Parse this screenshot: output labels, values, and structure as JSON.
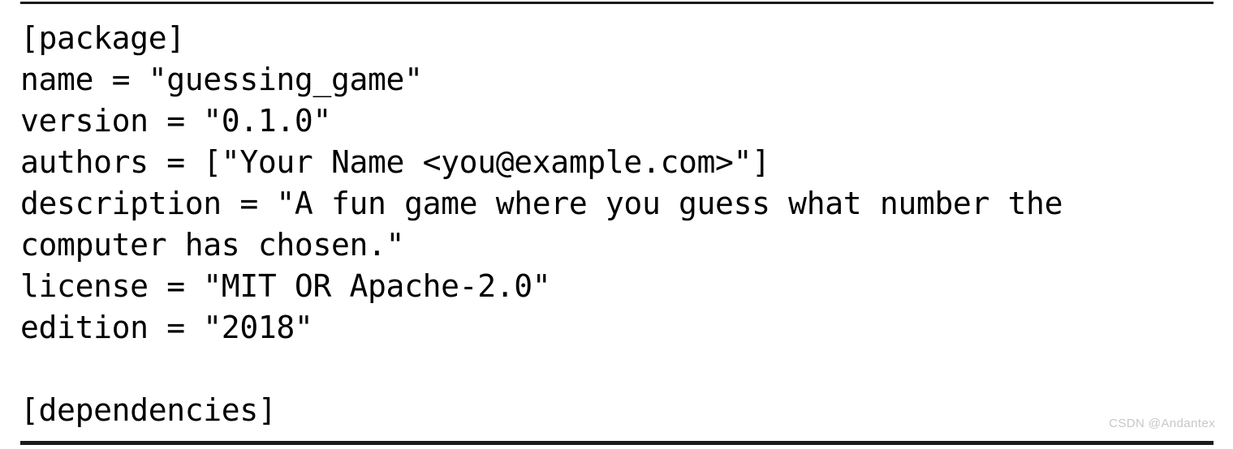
{
  "document": {
    "kind": "code-block",
    "language": "toml",
    "filename": "Cargo.toml",
    "background_color": "#ffffff",
    "text_color": "#000000",
    "rule_color": "#1a1a1a"
  },
  "code": {
    "lines": [
      "[package]",
      "name = \"guessing_game\"",
      "version = \"0.1.0\"",
      "authors = [\"Your Name <you@example.com>\"]",
      "description = \"A fun game where you guess what number the computer has chosen.\"",
      "license = \"MIT OR Apache-2.0\"",
      "edition = \"2018\"",
      "",
      "[dependencies]"
    ],
    "full_text": "[package]\nname = \"guessing_game\"\nversion = \"0.1.0\"\nauthors = [\"Your Name <you@example.com>\"]\ndescription = \"A fun game where you guess what number the computer has chosen.\"\nlicense = \"MIT OR Apache-2.0\"\nedition = \"2018\"\n\n[dependencies]",
    "fields": {
      "section_package": "[package]",
      "name": "guessing_game",
      "version": "0.1.0",
      "authors": "Your Name <you@example.com>",
      "description": "A fun game where you guess what number the computer has chosen.",
      "license": "MIT OR Apache-2.0",
      "edition": "2018",
      "section_dependencies": "[dependencies]"
    }
  },
  "watermark": {
    "text": "CSDN @Andantex",
    "color": "#c7c7c7"
  }
}
